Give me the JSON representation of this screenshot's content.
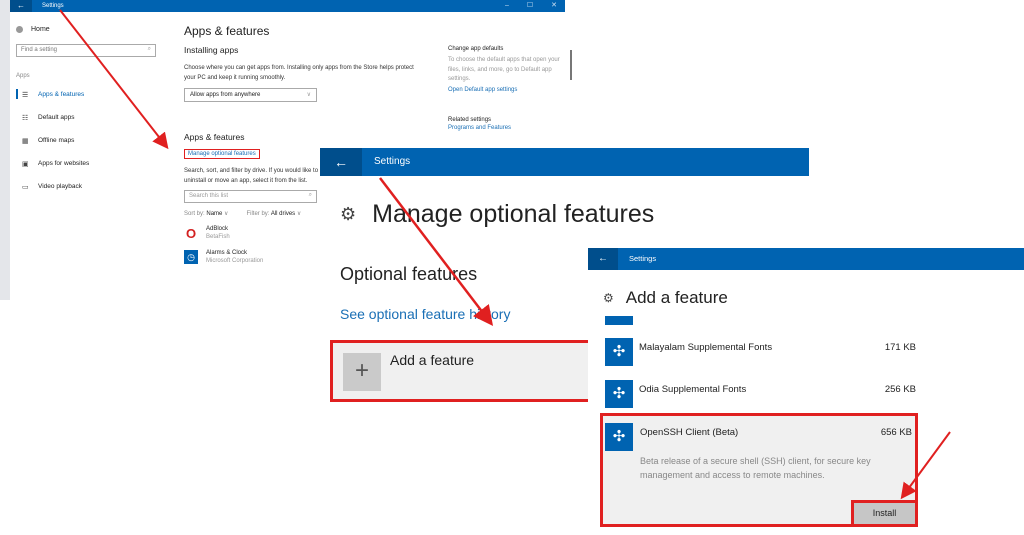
{
  "colors": {
    "titlebar": "#0063b1",
    "titlebar_back": "#004e8c",
    "link": "#1a6fb5",
    "highlight": "#e02020",
    "tile": "#0063b1"
  },
  "window1": {
    "title": "Settings",
    "back_icon": "arrow-left-icon",
    "window_controls": [
      "–",
      "☐",
      "✕"
    ],
    "sidebar": {
      "home_label": "Home",
      "search_placeholder": "Find a setting",
      "section_label": "Apps",
      "items": [
        {
          "label": "Apps & features",
          "icon": "list-icon",
          "active": true
        },
        {
          "label": "Default apps",
          "icon": "default-apps-icon",
          "active": false
        },
        {
          "label": "Offline maps",
          "icon": "map-icon",
          "active": false
        },
        {
          "label": "Apps for websites",
          "icon": "web-icon",
          "active": false
        },
        {
          "label": "Video playback",
          "icon": "video-icon",
          "active": false
        }
      ]
    },
    "main": {
      "page_title": "Apps & features",
      "installing_heading": "Installing apps",
      "installing_text": "Choose where you can get apps from. Installing only apps from the Store helps protect your PC and keep it running smoothly.",
      "install_source_value": "Allow apps from anywhere",
      "apps_heading": "Apps & features",
      "manage_link": "Manage optional features",
      "search_text": "Search, sort, and filter by drive. If you would like to uninstall or move an app, select it from the list.",
      "search_list_placeholder": "Search this list",
      "sort_label": "Sort by:",
      "sort_value": "Name",
      "filter_label": "Filter by:",
      "filter_value": "All drives",
      "apps": [
        {
          "name": "AdBlock",
          "publisher": "BetaFish"
        },
        {
          "name": "Alarms & Clock",
          "publisher": "Microsoft Corporation"
        }
      ]
    },
    "right": {
      "defaults_heading": "Change app defaults",
      "defaults_text": "To choose the default apps that open your files, links, and more, go to Default app settings.",
      "defaults_link": "Open Default app settings",
      "related_heading": "Related settings",
      "related_link": "Programs and Features"
    }
  },
  "window2": {
    "title": "Settings",
    "page_title": "Manage optional features",
    "section_heading": "Optional features",
    "history_link": "See optional feature history",
    "add_feature_label": "Add a feature"
  },
  "window3": {
    "title": "Settings",
    "page_title": "Add a feature",
    "features": [
      {
        "name": "Malayalam Supplemental Fonts",
        "size": "171 KB"
      },
      {
        "name": "Odia Supplemental Fonts",
        "size": "256 KB"
      }
    ],
    "selected": {
      "name": "OpenSSH Client (Beta)",
      "size": "656 KB",
      "description": "Beta release of a secure shell (SSH) client, for secure key management and access to remote machines.",
      "install_label": "Install"
    }
  }
}
